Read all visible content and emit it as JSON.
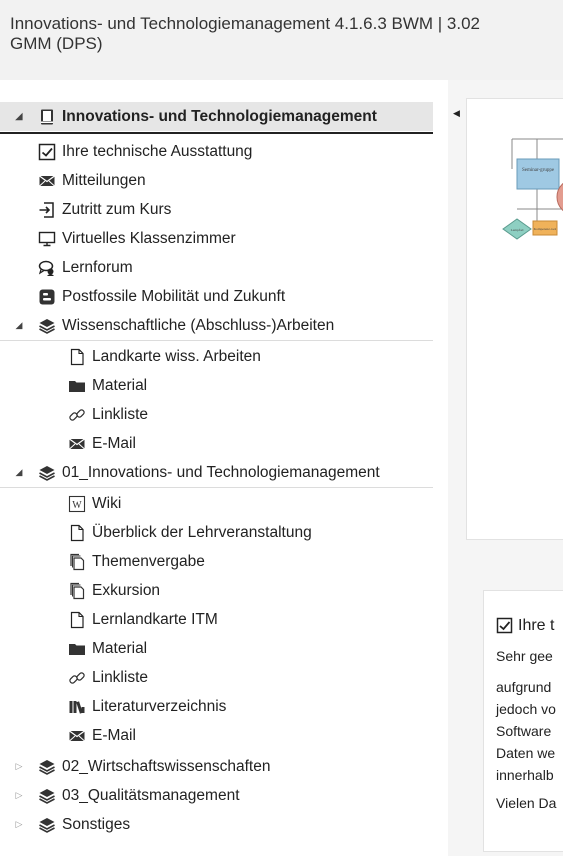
{
  "header": {
    "title_line1": "Innovations- und Technologiemanagement 4.1.6.3 BWM | 3.02",
    "title_line2": "GMM (DPS)"
  },
  "sidebar": {
    "items": [
      {
        "label": "Innovations- und Technologiemanagement",
        "icon": "book-icon"
      },
      {
        "label": "Ihre technische Ausstattung",
        "icon": "checkbox-icon"
      },
      {
        "label": "Mitteilungen",
        "icon": "envelope-icon"
      },
      {
        "label": "Zutritt zum Kurs",
        "icon": "enter-icon"
      },
      {
        "label": "Virtuelles Klassenzimmer",
        "icon": "monitor-icon"
      },
      {
        "label": "Lernforum",
        "icon": "forum-icon"
      },
      {
        "label": "Postfossile Mobilität und Zukunft",
        "icon": "blog-icon"
      },
      {
        "label": "Wissenschaftliche (Abschluss-)Arbeiten",
        "icon": "layers-icon"
      },
      {
        "label": "Landkarte wiss. Arbeiten",
        "icon": "page-icon"
      },
      {
        "label": "Material",
        "icon": "folder-icon"
      },
      {
        "label": "Linkliste",
        "icon": "link-icon"
      },
      {
        "label": "E-Mail",
        "icon": "envelope-icon"
      },
      {
        "label": "01_Innovations- und Technologiemanagement",
        "icon": "layers-icon"
      },
      {
        "label": "Wiki",
        "icon": "wiki-icon"
      },
      {
        "label": "Überblick der Lehrveranstaltung",
        "icon": "page-icon"
      },
      {
        "label": "Themenvergabe",
        "icon": "copy-icon"
      },
      {
        "label": "Exkursion",
        "icon": "copy-icon"
      },
      {
        "label": "Lernlandkarte ITM",
        "icon": "page-icon"
      },
      {
        "label": "Material",
        "icon": "folder-icon"
      },
      {
        "label": "Linkliste",
        "icon": "link-icon"
      },
      {
        "label": "Literaturverzeichnis",
        "icon": "library-icon"
      },
      {
        "label": "E-Mail",
        "icon": "envelope-icon"
      },
      {
        "label": "02_Wirtschaftswissenschaften",
        "icon": "layers-icon"
      },
      {
        "label": "03_Qualitätsmanagement",
        "icon": "layers-icon"
      },
      {
        "label": "Sonstiges",
        "icon": "layers-icon"
      }
    ]
  },
  "main": {
    "diagram_labels": [
      "Seminar-gruppe",
      "M",
      "Kompetenz-tool",
      "Lernpfad"
    ],
    "card2": {
      "title": "Ihre t",
      "lines": [
        "Sehr gee",
        "aufgrund",
        "jedoch vo",
        "Software",
        "Daten we",
        "innerhalb",
        "Vielen Da"
      ]
    }
  }
}
